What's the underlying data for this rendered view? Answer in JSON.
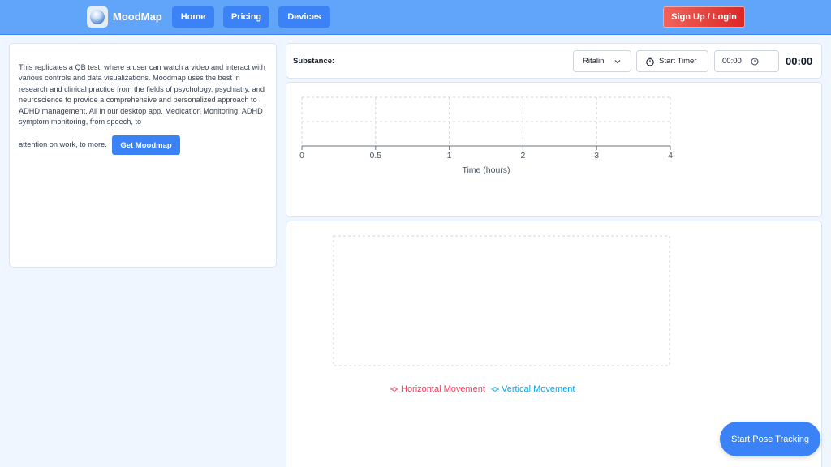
{
  "navbar": {
    "logo_text": "MoodMap",
    "links": [
      "Home",
      "Pricing",
      "Devices"
    ],
    "login_label": "Sign Up / Login"
  },
  "info": {
    "text": "This replicates a QB test, where a user can watch a video and interact with various controls and data visualizations. Moodmap uses the best in research and clinical practice from the fields of psychology, psychiatry, and neuroscience to provide a comprehensive and personalized approach to ADHD management. All in our desktop app. Medication Monitoring, ADHD symptom monitoring, from speech, to",
    "tail": "attention on work, to more.",
    "cta_label": "Get Moodmap"
  },
  "controls": {
    "substance_label": "Substance:",
    "substance_value": "Ritalin",
    "timer_label": "Start Timer",
    "time_input_value": "00:00",
    "time_display": "00:00"
  },
  "chart_data": [
    {
      "type": "line",
      "xlabel": "Time (hours)",
      "x_ticks": [
        "0",
        "0.5",
        "1",
        "2",
        "3",
        "4"
      ],
      "xlim": [
        0,
        4
      ],
      "series": [],
      "grid": true
    },
    {
      "type": "line",
      "series": [
        {
          "name": "Horizontal Movement",
          "values": [],
          "color": "#f43f5e"
        },
        {
          "name": "Vertical Movement",
          "values": [],
          "color": "#0ea5e9"
        }
      ],
      "grid": true,
      "legend": "bottom"
    }
  ],
  "pose": {
    "button_label": "Start Pose Tracking"
  },
  "icons": {
    "logo": "moodmap-logo-icon",
    "select": "chevron-down-icon",
    "timer": "stopwatch-icon",
    "time": "clock-icon"
  }
}
